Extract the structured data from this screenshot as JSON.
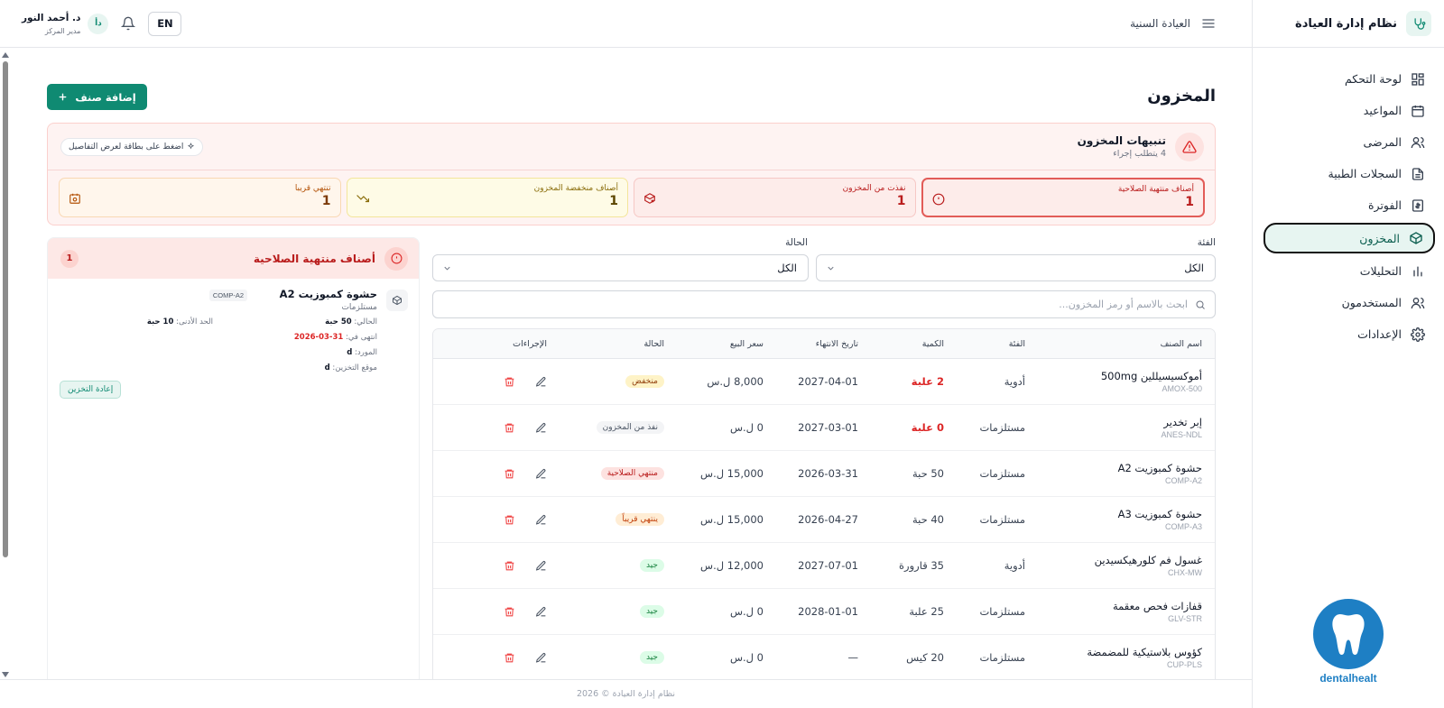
{
  "app": {
    "title": "نظام إدارة العيادة"
  },
  "sidebar": {
    "items": [
      {
        "label": "لوحة التحكم",
        "icon": "dashboard-icon"
      },
      {
        "label": "المواعيد",
        "icon": "calendar-icon"
      },
      {
        "label": "المرضى",
        "icon": "users-icon"
      },
      {
        "label": "السجلات الطبية",
        "icon": "file-icon"
      },
      {
        "label": "الفوترة",
        "icon": "invoice-icon"
      },
      {
        "label": "المخزون",
        "icon": "package-icon",
        "active": true
      },
      {
        "label": "التحليلات",
        "icon": "bar-chart-icon"
      },
      {
        "label": "المستخدمون",
        "icon": "users-icon"
      },
      {
        "label": "الإعدادات",
        "icon": "gear-icon"
      }
    ],
    "logo_text": "dentalhealt"
  },
  "header": {
    "clinic": "العيادة السنية",
    "lang": "EN",
    "user_name": "د. أحمد النور",
    "user_role": "مدير المركز",
    "avatar": "دأ"
  },
  "page": {
    "title": "المخزون",
    "add_button": "إضافة صنف"
  },
  "alerts": {
    "title": "تنبيهات المخزون",
    "subtitle": "4 يتطلب إجراء",
    "hint": "اضغط على بطاقة لعرض التفاصيل",
    "cards": [
      {
        "label": "أصناف منتهية الصلاحية",
        "value": "1"
      },
      {
        "label": "نفذت من المخزون",
        "value": "1"
      },
      {
        "label": "أصناف منخفضة المخزون",
        "value": "1"
      },
      {
        "label": "تنتهي قريبا",
        "value": "1"
      }
    ]
  },
  "filters": {
    "category_label": "الفئة",
    "category_value": "الكل",
    "status_label": "الحالة",
    "status_value": "الكل",
    "search_placeholder": "ابحث بالاسم أو رمز المخزون..."
  },
  "table": {
    "headers": {
      "name": "اسم الصنف",
      "category": "الفئة",
      "quantity": "الكمية",
      "expiry": "تاريخ الانتهاء",
      "price": "سعر البيع",
      "status": "الحالة",
      "actions": "الإجراءات"
    },
    "rows": [
      {
        "name": "أموكسيسيللين 500mg",
        "code": "AMOX-500",
        "category": "أدوية",
        "quantity": "2 علبة",
        "qty_alert": true,
        "expiry": "2027-04-01",
        "price": "8,000 ل.س",
        "status": "منخفض",
        "status_kind": "low"
      },
      {
        "name": "إبر تخدير",
        "code": "ANES-NDL",
        "category": "مستلزمات",
        "quantity": "0 علبة",
        "qty_alert": true,
        "expiry": "2027-03-01",
        "price": "0 ل.س",
        "status": "نفذ من المخزون",
        "status_kind": "out"
      },
      {
        "name": "حشوة كمبوزيت A2",
        "code": "COMP-A2",
        "category": "مستلزمات",
        "quantity": "50 حبة",
        "qty_alert": false,
        "expiry": "2026-03-31",
        "price": "15,000 ل.س",
        "status": "منتهي الصلاحية",
        "status_kind": "exp"
      },
      {
        "name": "حشوة كمبوزيت A3",
        "code": "COMP-A3",
        "category": "مستلزمات",
        "quantity": "40 حبة",
        "qty_alert": false,
        "expiry": "2026-04-27",
        "price": "15,000 ل.س",
        "status": "ينتهي قريباً",
        "status_kind": "soon"
      },
      {
        "name": "غسول فم كلورهيكسيدين",
        "code": "CHX-MW",
        "category": "أدوية",
        "quantity": "35 قارورة",
        "qty_alert": false,
        "expiry": "2027-07-01",
        "price": "12,000 ل.س",
        "status": "جيد",
        "status_kind": "good"
      },
      {
        "name": "قفازات فحص معقمة",
        "code": "GLV-STR",
        "category": "مستلزمات",
        "quantity": "25 علبة",
        "qty_alert": false,
        "expiry": "2028-01-01",
        "price": "0 ل.س",
        "status": "جيد",
        "status_kind": "good"
      },
      {
        "name": "كؤوس بلاستيكية للمضمضة",
        "code": "CUP-PLS",
        "category": "مستلزمات",
        "quantity": "20 كيس",
        "qty_alert": false,
        "expiry": "—",
        "price": "0 ل.س",
        "status": "جيد",
        "status_kind": "good"
      }
    ]
  },
  "panel": {
    "title": "أصناف منتهية الصلاحية",
    "count": "1",
    "item": {
      "name": "حشوة كمبوزيت A2",
      "code": "COMP-A2",
      "category": "مستلزمات",
      "current_label": "الحالي:",
      "current_value": "50 حبة",
      "min_label": "الحد الأدنى:",
      "min_value": "10 حبة",
      "expired_label": "انتهى في:",
      "expired_value": "31-03-2026",
      "supplier_label": "المورد:",
      "supplier_value": "d",
      "location_label": "موقع التخزين:",
      "location_value": "d",
      "restock": "إعادة التخزين"
    }
  },
  "footer": {
    "text": "نظام إدارة العيادة © 2026"
  },
  "colors": {
    "primary": "#0f8a72",
    "danger": "#dc2626",
    "warning": "#f59e0b"
  }
}
